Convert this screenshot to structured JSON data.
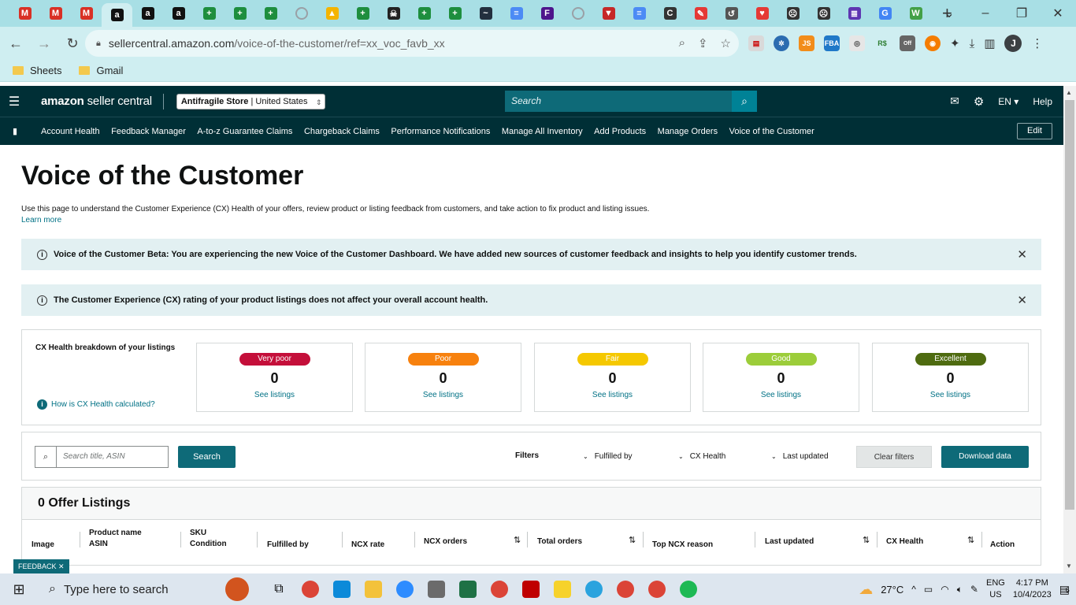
{
  "browser": {
    "tabs": [
      {
        "icon": "gmail-icon",
        "color": "#d93025",
        "glyph": "M"
      },
      {
        "icon": "gmail-icon",
        "color": "#d93025",
        "glyph": "M"
      },
      {
        "icon": "gmail-icon",
        "color": "#d93025",
        "glyph": "M"
      },
      {
        "icon": "amazon-icon",
        "color": "#111111",
        "glyph": "a",
        "active": true
      },
      {
        "icon": "amazon-icon",
        "color": "#111111",
        "glyph": "a"
      },
      {
        "icon": "amazon-icon",
        "color": "#111111",
        "glyph": "a"
      },
      {
        "icon": "sheets-icon",
        "color": "#1e8e3e",
        "glyph": "+"
      },
      {
        "icon": "sheets-icon",
        "color": "#1e8e3e",
        "glyph": "+"
      },
      {
        "icon": "sheets-icon",
        "color": "#1e8e3e",
        "glyph": "+"
      },
      {
        "icon": "loading-icon",
        "color": "#9aa0a6",
        "glyph": ""
      },
      {
        "icon": "drive-icon",
        "color": "#f4b400",
        "glyph": "▲"
      },
      {
        "icon": "sheets-icon",
        "color": "#1e8e3e",
        "glyph": "+"
      },
      {
        "icon": "skull-icon",
        "color": "#222222",
        "glyph": "☠"
      },
      {
        "icon": "sheets-icon",
        "color": "#1e8e3e",
        "glyph": "+"
      },
      {
        "icon": "sheets-icon",
        "color": "#1e8e3e",
        "glyph": "+"
      },
      {
        "icon": "amazon-smile-icon",
        "color": "#232f3e",
        "glyph": "~"
      },
      {
        "icon": "stack-icon",
        "color": "#4c8bf5",
        "glyph": "≡"
      },
      {
        "icon": "fedex-icon",
        "color": "#4d148c",
        "glyph": "F"
      },
      {
        "icon": "loading-icon",
        "color": "#9aa0a6",
        "glyph": ""
      },
      {
        "icon": "vpn-icon",
        "color": "#c62828",
        "glyph": "▼"
      },
      {
        "icon": "stack-icon",
        "color": "#4c8bf5",
        "glyph": "≡"
      },
      {
        "icon": "c-icon",
        "color": "#333333",
        "glyph": "C"
      },
      {
        "icon": "image-icon",
        "color": "#e53935",
        "glyph": "✎"
      },
      {
        "icon": "history-icon",
        "color": "#555555",
        "glyph": "↺"
      },
      {
        "icon": "heart-icon",
        "color": "#e53935",
        "glyph": "♥"
      },
      {
        "icon": "face-icon",
        "color": "#333333",
        "glyph": "☹"
      },
      {
        "icon": "face-icon",
        "color": "#333333",
        "glyph": "☹"
      },
      {
        "icon": "list-icon",
        "color": "#5e35b1",
        "glyph": "≣"
      },
      {
        "icon": "google-icon",
        "color": "#4285f4",
        "glyph": "G"
      },
      {
        "icon": "w-icon",
        "color": "#43a047",
        "glyph": "W"
      }
    ],
    "url_host": "sellercentral.amazon.com",
    "url_path": "/voice-of-the-customer/ref=xx_voc_favb_xx",
    "profile_initial": "J",
    "bookmarks": [
      "Sheets",
      "Gmail"
    ]
  },
  "header": {
    "logo_main": "amazon",
    "logo_sub": "seller central",
    "store_name": "Antifragile Store",
    "store_marketplace": "United States",
    "search_placeholder": "Search",
    "language": "EN",
    "help": "Help"
  },
  "nav": {
    "items": [
      "Account Health",
      "Feedback Manager",
      "A-to-z Guarantee Claims",
      "Chargeback Claims",
      "Performance Notifications",
      "Manage All Inventory",
      "Add Products",
      "Manage Orders",
      "Voice of the Customer"
    ],
    "edit": "Edit"
  },
  "page": {
    "title": "Voice of the Customer",
    "description": "Use this page to understand the Customer Experience (CX) Health of your offers, review product or listing feedback from customers, and take action to fix product and listing issues.",
    "learn_more": "Learn more",
    "alert_beta": "Voice of the Customer Beta: You are experiencing the new Voice of the Customer Dashboard. We have added new sources of customer feedback and insights to help you identify customer trends.",
    "alert_rating": "The Customer Experience (CX) rating of your product listings does not affect your overall account health."
  },
  "cx": {
    "title": "CX Health breakdown of your listings",
    "help_link": "How is CX Health calculated?",
    "ratings": [
      {
        "label": "Very poor",
        "count": "0",
        "link": "See listings",
        "color": "#c40f3a"
      },
      {
        "label": "Poor",
        "count": "0",
        "link": "See listings",
        "color": "#f7810e"
      },
      {
        "label": "Fair",
        "count": "0",
        "link": "See listings",
        "color": "#f5c800"
      },
      {
        "label": "Good",
        "count": "0",
        "link": "See listings",
        "color": "#9ccd3a"
      },
      {
        "label": "Excellent",
        "count": "0",
        "link": "See listings",
        "color": "#4e6b10"
      }
    ]
  },
  "filters": {
    "search_placeholder": "Search title, ASIN",
    "search_button": "Search",
    "label": "Filters",
    "fulfilled_by": "Fulfilled by",
    "cx_health": "CX Health",
    "last_updated": "Last updated",
    "clear": "Clear filters",
    "download": "Download data"
  },
  "listings": {
    "title": "0 Offer Listings",
    "columns": {
      "image": "Image",
      "product_name": "Product name",
      "asin": "ASIN",
      "sku": "SKU",
      "condition": "Condition",
      "fulfilled_by": "Fulfilled by",
      "ncx_rate": "NCX rate",
      "ncx_orders": "NCX orders",
      "total_orders": "Total orders",
      "top_ncx_reason": "Top NCX reason",
      "last_updated": "Last updated",
      "cx_health": "CX Health",
      "action": "Action"
    }
  },
  "feedback": "FEEDBACK",
  "taskbar": {
    "search_placeholder": "Type here to search",
    "weather": "27°C",
    "lang_1": "ENG",
    "lang_2": "US",
    "time": "4:17 PM",
    "date": "10/4/2023",
    "notifications": "6",
    "apps": [
      {
        "name": "chrome-icon",
        "color": "#db4437"
      },
      {
        "name": "edge-icon",
        "color": "#0c8ad9"
      },
      {
        "name": "file-explorer-icon",
        "color": "#f3c23a"
      },
      {
        "name": "zoom-icon",
        "color": "#2d8cff"
      },
      {
        "name": "calculator-icon",
        "color": "#6b6b6b"
      },
      {
        "name": "excel-icon",
        "color": "#1e7145"
      },
      {
        "name": "chrome-icon",
        "color": "#db4437"
      },
      {
        "name": "filezilla-icon",
        "color": "#bf0000"
      },
      {
        "name": "sticky-notes-icon",
        "color": "#f6d22b"
      },
      {
        "name": "telegram-icon",
        "color": "#2aa3de"
      },
      {
        "name": "chrome-icon",
        "color": "#db4437"
      },
      {
        "name": "chrome-icon",
        "color": "#db4437"
      },
      {
        "name": "spotify-icon",
        "color": "#1db954"
      }
    ]
  }
}
